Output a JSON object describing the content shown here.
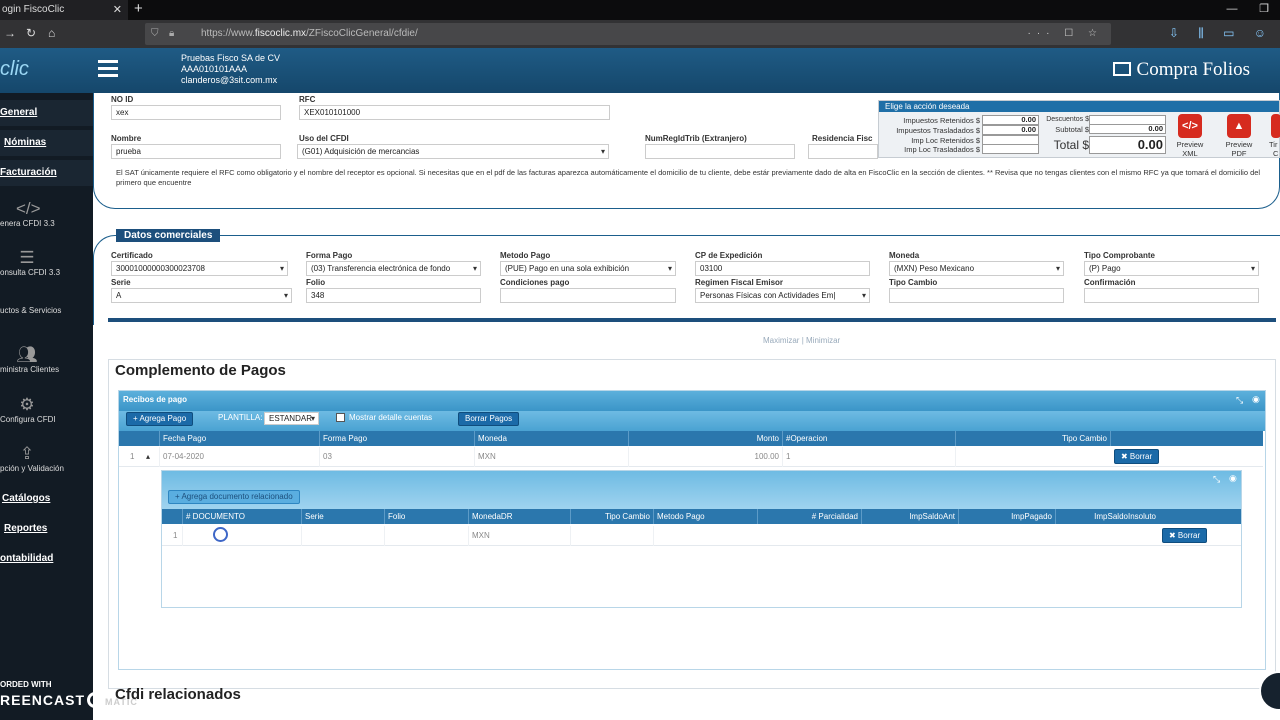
{
  "browser": {
    "tab_title": "ogin FiscoClic",
    "url_prefix": "https://www.",
    "url_host": "fiscoclic.mx",
    "url_path": "/ZFiscoClicGeneral/cfdie/"
  },
  "header": {
    "logo": "clic",
    "company_name": "Pruebas Fisco SA de CV",
    "company_rfc": "AAA010101AAA",
    "company_email": "clanderos@3sit.com.mx",
    "page_title": "Compra Folios"
  },
  "sidebar": {
    "categories": [
      "General",
      "Nóminas",
      "Facturación",
      "Catálogos",
      "Reportes",
      "Contabilidad"
    ],
    "categories_visible": [
      "General",
      "Nóminas",
      "Facturación",
      "Catálogos",
      "Reportes",
      "ontabilidad"
    ],
    "items": [
      "enera CFDI 3.3",
      "onsulta CFDI 3.3",
      "uctos & Servicios",
      "ministra Clientes",
      "Configura CFDI",
      "pción y Validación"
    ],
    "recorded_label": "ORDED WITH",
    "screencast_label": "REENCAST",
    "screencast_suffix": "MATIC"
  },
  "receptor": {
    "no_id_label": "NO ID",
    "no_id_value": "xex",
    "rfc_label": "RFC",
    "rfc_value": "XEX010101000",
    "nombre_label": "Nombre",
    "nombre_value": "prueba",
    "uso_cfdi_label": "Uso del CFDI",
    "uso_cfdi_value": "(G01) Adquisición de mercancias",
    "numreg_label": "NumRegIdTrib (Extranjero)",
    "residencia_label": "Residencia Fisc",
    "note": "El SAT únicamente requiere el RFC como obligatorio y el nombre del receptor es opcional. Si necesitas que en el pdf de las facturas aparezca automáticamente el domicilio de tu cliente, debe estár previamente dado de alta en FiscoClic en la sección de clientes. ** Revisa que no tengas clientes con el mismo RFC ya que tomará el domicilio del primero que encuentre"
  },
  "taxbox": {
    "header": "Elige la acción deseada",
    "imp_retenidos": "Impuestos Retenidos $",
    "imp_retenidos_val": "0.00",
    "imp_trasladados": "Impuestos Trasladados $",
    "imp_trasladados_val": "0.00",
    "imp_loc_ret": "Imp Loc Retenidos $",
    "imp_loc_tras": "Imp Loc Trasladados $",
    "descuentos": "Descuentos $",
    "subtotal": "Subtotal $",
    "subtotal_val": "0.00",
    "total": "Total $",
    "total_val": "0.00",
    "preview_xml": [
      "Preview",
      "XML"
    ],
    "preview_pdf": [
      "Preview",
      "PDF"
    ],
    "third_btn": [
      "Tir",
      "C"
    ]
  },
  "datos_comerciales": {
    "title": "Datos comerciales",
    "certificado_label": "Certificado",
    "certificado_value": "30001000000300023708",
    "forma_pago_label": "Forma Pago",
    "forma_pago_value": "(03) Transferencia electrónica de fondo",
    "metodo_pago_label": "Metodo Pago",
    "metodo_pago_value": "(PUE) Pago en una sola exhibición",
    "cp_label": "CP de Expedición",
    "cp_value": "03100",
    "moneda_label": "Moneda",
    "moneda_value": "(MXN) Peso Mexicano",
    "tipo_comp_label": "Tipo Comprobante",
    "tipo_comp_value": "(P) Pago",
    "serie_label": "Serie",
    "serie_value": "A",
    "folio_label": "Folio",
    "folio_value": "348",
    "condiciones_label": "Condiciones pago",
    "regimen_label": "Regimen Fiscal Emisor",
    "regimen_value": "Personas Físicas con Actividades Em|",
    "tipo_cambio_label": "Tipo Cambio",
    "confirmacion_label": "Confirmación",
    "maximizar": "Maximizar",
    "separator": "|",
    "minimizar": "Minimizar"
  },
  "complemento": {
    "title": "Complemento de Pagos",
    "recibos_title": "Recibos de pago",
    "agrega_pago": "+ Agrega Pago",
    "plantilla_label": "PLANTILLA:",
    "plantilla_value": "ESTANDAR",
    "mostrar_detalle": "Mostrar detalle cuentas",
    "borrar_pagos": "Borrar Pagos",
    "columns": [
      "Fecha Pago",
      "Forma Pago",
      "Moneda",
      "Monto",
      "#Operacion",
      "Tipo Cambio"
    ],
    "row": {
      "num": "1",
      "expander": "▴",
      "fecha": "07-04-2020",
      "forma": "03",
      "moneda": "MXN",
      "monto": "100.00",
      "operacion": "1",
      "borrar": "✖ Borrar"
    },
    "agrega_doc": "+ Agrega documento relacionado",
    "doc_columns": [
      "# DOCUMENTO",
      "Serie",
      "Folio",
      "MonedaDR",
      "Tipo Cambio",
      "Metodo Pago",
      "# Parcialidad",
      "ImpSaldoAnt",
      "ImpPagado",
      "ImpSaldoInsoluto"
    ],
    "doc_row": {
      "num": "1",
      "moneda": "MXN",
      "borrar": "✖ Borrar"
    }
  },
  "cfdi_relacionados": {
    "title": "Cfdi relacionados"
  },
  "colors": {
    "header_blue": "#1b5e8c",
    "grid_blue": "#2b77ad",
    "ribbon_blue": "#4aa2d2",
    "red": "#d62b1f"
  }
}
